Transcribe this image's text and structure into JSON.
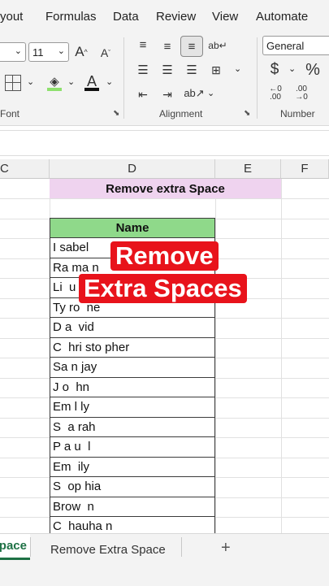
{
  "menu": [
    "yout",
    "Formulas",
    "Data",
    "Review",
    "View",
    "Automate"
  ],
  "ribbon": {
    "font_size": "11",
    "font_group_label": "Font",
    "alignment_group_label": "Alignment",
    "number_format": "General",
    "number_group_label": "Number"
  },
  "columns": [
    "C",
    "D",
    "E",
    "F"
  ],
  "sheet": {
    "title": "Remove extra Space",
    "header": "Name",
    "names": [
      "I sabel",
      "Ra ma n",
      "Li  u",
      "Ty ro  ne",
      "D a  vid",
      "C  hri sto pher",
      "Sa n jay",
      "J o  hn",
      "Em l ly",
      "S  a rah",
      "P a u  l",
      "Em  ily",
      "S  op hia",
      "Brow  n",
      "C  hauha n"
    ]
  },
  "overlay": {
    "line1": "Remove",
    "line2": "Extra Spaces"
  },
  "tabs": {
    "active": "pace",
    "other": "Remove Extra Space",
    "add": "+"
  },
  "colors": {
    "title_bg": "#efd3ef",
    "header_bg": "#8fd98a",
    "overlay_bg": "#e8131b"
  }
}
